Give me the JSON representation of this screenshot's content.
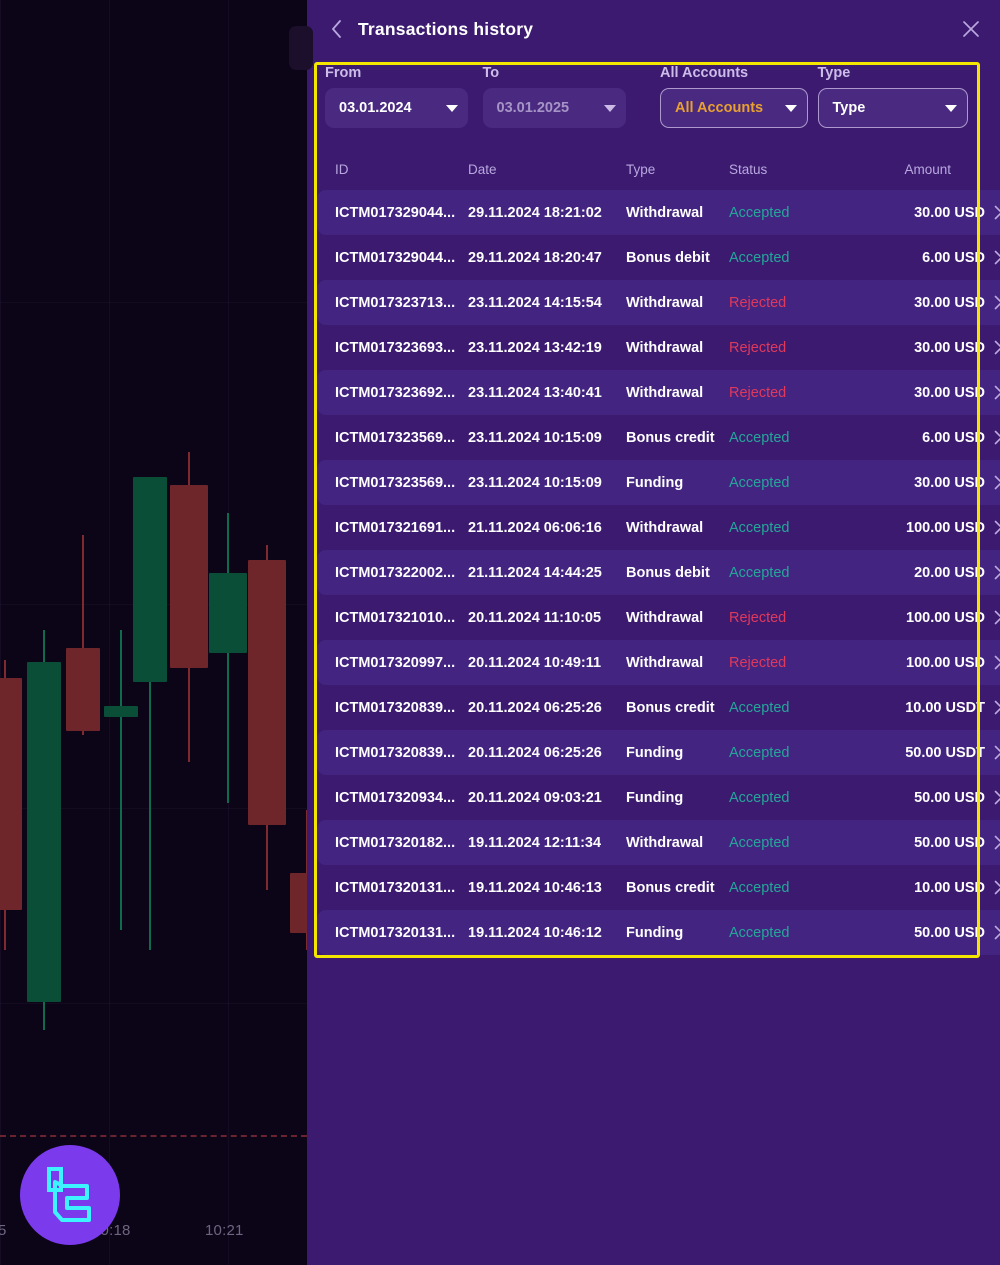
{
  "panel": {
    "title": "Transactions history",
    "back_icon": "chevron-left-icon",
    "close_icon": "close-icon"
  },
  "filters": [
    {
      "label": "From",
      "value": "03.01.2024",
      "style": "white",
      "outlined": false
    },
    {
      "label": "To",
      "value": "03.01.2025",
      "style": "dim",
      "outlined": false
    },
    {
      "label": "All Accounts",
      "value": "All Accounts",
      "style": "gold",
      "outlined": true
    },
    {
      "label": "Type",
      "value": "Type",
      "style": "white",
      "outlined": true
    }
  ],
  "table": {
    "columns": [
      "ID",
      "Date",
      "Type",
      "Status",
      "Amount"
    ],
    "rows": [
      {
        "id": "ICTM017329044...",
        "date": "29.11.2024 18:21:02",
        "type": "Withdrawal",
        "status": "Accepted",
        "amount": "30.00 USD"
      },
      {
        "id": "ICTM017329044...",
        "date": "29.11.2024 18:20:47",
        "type": "Bonus debit",
        "status": "Accepted",
        "amount": "6.00 USD"
      },
      {
        "id": "ICTM017323713...",
        "date": "23.11.2024 14:15:54",
        "type": "Withdrawal",
        "status": "Rejected",
        "amount": "30.00 USD"
      },
      {
        "id": "ICTM017323693...",
        "date": "23.11.2024 13:42:19",
        "type": "Withdrawal",
        "status": "Rejected",
        "amount": "30.00 USD"
      },
      {
        "id": "ICTM017323692...",
        "date": "23.11.2024 13:40:41",
        "type": "Withdrawal",
        "status": "Rejected",
        "amount": "30.00 USD"
      },
      {
        "id": "ICTM017323569...",
        "date": "23.11.2024 10:15:09",
        "type": "Bonus credit",
        "status": "Accepted",
        "amount": "6.00 USD"
      },
      {
        "id": "ICTM017323569...",
        "date": "23.11.2024 10:15:09",
        "type": "Funding",
        "status": "Accepted",
        "amount": "30.00 USD"
      },
      {
        "id": "ICTM017321691...",
        "date": "21.11.2024 06:06:16",
        "type": "Withdrawal",
        "status": "Accepted",
        "amount": "100.00 USD"
      },
      {
        "id": "ICTM017322002...",
        "date": "21.11.2024 14:44:25",
        "type": "Bonus debit",
        "status": "Accepted",
        "amount": "20.00 USD"
      },
      {
        "id": "ICTM017321010...",
        "date": "20.11.2024 11:10:05",
        "type": "Withdrawal",
        "status": "Rejected",
        "amount": "100.00 USD"
      },
      {
        "id": "ICTM017320997...",
        "date": "20.11.2024 10:49:11",
        "type": "Withdrawal",
        "status": "Rejected",
        "amount": "100.00 USD"
      },
      {
        "id": "ICTM017320839...",
        "date": "20.11.2024 06:25:26",
        "type": "Bonus credit",
        "status": "Accepted",
        "amount": "10.00 USDT"
      },
      {
        "id": "ICTM017320839...",
        "date": "20.11.2024 06:25:26",
        "type": "Funding",
        "status": "Accepted",
        "amount": "50.00 USDT"
      },
      {
        "id": "ICTM017320934...",
        "date": "20.11.2024 09:03:21",
        "type": "Funding",
        "status": "Accepted",
        "amount": "50.00 USD"
      },
      {
        "id": "ICTM017320182...",
        "date": "19.11.2024 12:11:34",
        "type": "Withdrawal",
        "status": "Accepted",
        "amount": "50.00 USD"
      },
      {
        "id": "ICTM017320131...",
        "date": "19.11.2024 10:46:13",
        "type": "Bonus credit",
        "status": "Accepted",
        "amount": "10.00 USD"
      },
      {
        "id": "ICTM017320131...",
        "date": "19.11.2024 10:46:12",
        "type": "Funding",
        "status": "Accepted",
        "amount": "50.00 USD"
      }
    ],
    "row_chevron_icon": "chevron-right-icon"
  },
  "chart_data": {
    "type": "candlestick",
    "title": "",
    "xlabel": "",
    "ylabel": "",
    "x_tick_labels": [
      "5",
      "10:18",
      "10:21"
    ],
    "colors": {
      "up_body": "#0b4e37",
      "up_wick": "#0e6b4d",
      "down_body": "#6f262b",
      "down_wick": "#7e2a2f",
      "background": "#0c0417",
      "grid": "#7d6ea0",
      "dashed_level": "#7a2a35"
    },
    "candles": [
      {
        "open": 55,
        "high": 58,
        "low": 18,
        "close": 22,
        "dir": "down"
      },
      {
        "open": 18,
        "high": 64,
        "low": 12,
        "close": 60,
        "dir": "up"
      },
      {
        "open": 66,
        "high": 83,
        "low": 62,
        "close": 57,
        "dir": "down"
      },
      {
        "open": 58,
        "high": 66,
        "low": 32,
        "close": 58,
        "dir": "up"
      },
      {
        "open": 49,
        "high": 90,
        "low": 28,
        "close": 76,
        "dir": "up"
      },
      {
        "open": 92,
        "high": 95,
        "low": 58,
        "close": 63,
        "dir": "down"
      },
      {
        "open": 63,
        "high": 86,
        "low": 42,
        "close": 74,
        "dir": "up"
      },
      {
        "open": 80,
        "high": 87,
        "low": 28,
        "close": 33,
        "dir": "down"
      },
      {
        "open": 33,
        "high": 33,
        "low": 18,
        "close": 22,
        "dir": "down"
      }
    ]
  },
  "logo": {
    "name": "brand-logo",
    "letter": "L"
  },
  "highlight": {
    "color": "#f5e600"
  }
}
